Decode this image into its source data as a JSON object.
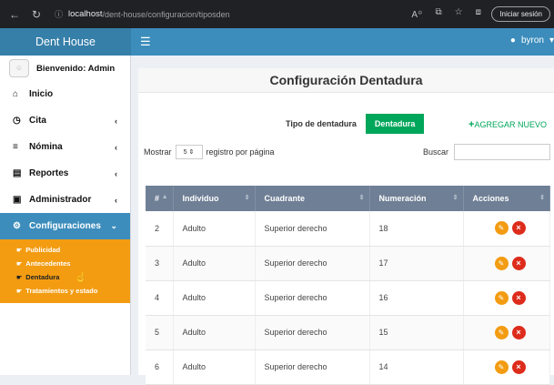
{
  "browser": {
    "url_host": "localhost",
    "url_path": "/dent-house/configuracion/tiposden",
    "login_label": "Iniciar sesión"
  },
  "header": {
    "brand": "Dent House",
    "user": "byron"
  },
  "sidebar": {
    "welcome": "Bienvenido: Admin",
    "items": [
      {
        "label": "Inicio",
        "icon": "home-icon"
      },
      {
        "label": "Cita",
        "icon": "clock-icon"
      },
      {
        "label": "Nómina",
        "icon": "list-icon"
      },
      {
        "label": "Reportes",
        "icon": "file-icon"
      },
      {
        "label": "Administrador",
        "icon": "lock-icon"
      },
      {
        "label": "Configuraciones",
        "icon": "cogs-icon"
      }
    ],
    "subitems": [
      {
        "label": "Publicidad"
      },
      {
        "label": "Antecedentes"
      },
      {
        "label": "Dentadura"
      },
      {
        "label": "Tratamientos y estado"
      }
    ]
  },
  "main": {
    "title": "Configuración Dentadura",
    "tab_tipo": "Tipo de dentadura",
    "tab_dentadura": "Dentadura",
    "add_new": "AGREGAR NUEVO",
    "show_label": "Mostrar",
    "show_value": "5",
    "per_page_label": "registro por página",
    "search_label": "Buscar",
    "search_placeholder": "",
    "columns": [
      "#",
      "Individuo",
      "Cuadrante",
      "Numeración",
      "Acciones"
    ],
    "rows": [
      {
        "num": "2",
        "individuo": "Adulto",
        "cuadrante": "Superior derecho",
        "numeracion": "18"
      },
      {
        "num": "3",
        "individuo": "Adulto",
        "cuadrante": "Superior derecho",
        "numeracion": "17"
      },
      {
        "num": "4",
        "individuo": "Adulto",
        "cuadrante": "Superior derecho",
        "numeracion": "16"
      },
      {
        "num": "5",
        "individuo": "Adulto",
        "cuadrante": "Superior derecho",
        "numeracion": "15"
      },
      {
        "num": "6",
        "individuo": "Adulto",
        "cuadrante": "Superior derecho",
        "numeracion": "14"
      }
    ]
  },
  "colors": {
    "primary": "#3c8dbc",
    "brand_dark": "#367fa9",
    "submenu": "#f39c12",
    "success": "#00a65a",
    "table_header": "#6f7f95",
    "danger": "#dd2c1c"
  }
}
